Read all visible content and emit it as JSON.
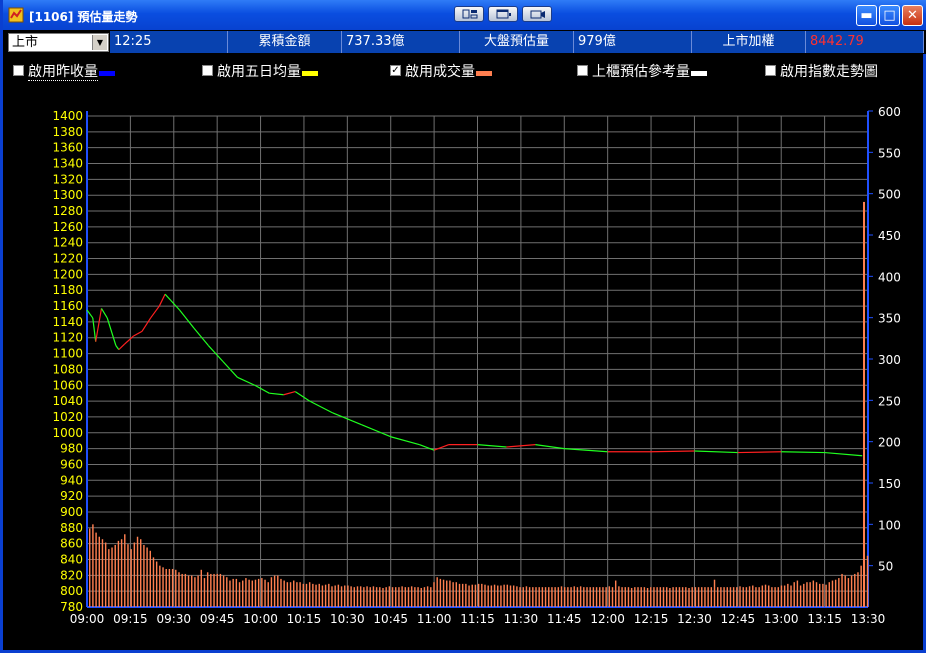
{
  "window": {
    "title": "[1106] 預估量走勢"
  },
  "toolbar": {
    "buttons": [
      "layout-icon",
      "window-icon",
      "camera-icon"
    ]
  },
  "info": {
    "market_select": "上市",
    "time": "12:25",
    "cumulative_label": "累積金額",
    "cumulative_value": "737.33億",
    "estimate_label": "大盤預估量",
    "estimate_value": "979億",
    "index_label": "上市加權",
    "index_value": "8442.79"
  },
  "options": [
    {
      "label": "啟用昨收量",
      "checked": false,
      "color": "#0000ff"
    },
    {
      "label": "啟用五日均量",
      "checked": false,
      "color": "#ffff00"
    },
    {
      "label": "啟用成交量",
      "checked": true,
      "color": "#ff7f50"
    },
    {
      "label": "上櫃預估參考量",
      "checked": false,
      "color": "#ffffff"
    },
    {
      "label": "啟用指數走勢圖",
      "checked": false,
      "color": ""
    }
  ],
  "colors": {
    "left_axis": "#ffff00",
    "right_axis": "#ffffff",
    "up": "#ff2020",
    "down": "#20ff20",
    "bars": "#ff7f50",
    "grid": "#707070"
  },
  "chart_data": {
    "type": "line",
    "title": "",
    "x_ticks": [
      "09:00",
      "09:15",
      "09:30",
      "09:45",
      "10:00",
      "10:15",
      "10:30",
      "10:45",
      "11:00",
      "11:15",
      "11:30",
      "11:45",
      "12:00",
      "12:15",
      "12:30",
      "12:45",
      "13:00",
      "13:15",
      "13:30"
    ],
    "y_left_ticks": [
      1400,
      1380,
      1360,
      1340,
      1320,
      1300,
      1280,
      1260,
      1240,
      1220,
      1200,
      1180,
      1160,
      1140,
      1120,
      1100,
      1080,
      1060,
      1040,
      1020,
      1000,
      980,
      960,
      940,
      920,
      900,
      880,
      860,
      840,
      820,
      800,
      780
    ],
    "y_right_ticks": [
      600,
      550,
      500,
      450,
      400,
      350,
      300,
      250,
      200,
      150,
      100,
      50
    ],
    "ylim_left": [
      780,
      1400
    ],
    "ylim_right": [
      0,
      600
    ],
    "series": [
      {
        "values": [
          {
            "t": "09:00",
            "v": 1155
          },
          {
            "t": "09:02",
            "v": 1145
          },
          {
            "t": "09:03",
            "v": 1115
          },
          {
            "t": "09:05",
            "v": 1157
          },
          {
            "t": "09:07",
            "v": 1145
          },
          {
            "t": "09:10",
            "v": 1110
          },
          {
            "t": "09:11",
            "v": 1105
          },
          {
            "t": "09:13",
            "v": 1112
          },
          {
            "t": "09:16",
            "v": 1122
          },
          {
            "t": "09:19",
            "v": 1128
          },
          {
            "t": "09:22",
            "v": 1145
          },
          {
            "t": "09:25",
            "v": 1160
          },
          {
            "t": "09:27",
            "v": 1175
          },
          {
            "t": "09:29",
            "v": 1167
          },
          {
            "t": "09:32",
            "v": 1155
          },
          {
            "t": "09:37",
            "v": 1132
          },
          {
            "t": "09:42",
            "v": 1110
          },
          {
            "t": "09:47",
            "v": 1090
          },
          {
            "t": "09:52",
            "v": 1070
          },
          {
            "t": "09:58",
            "v": 1060
          },
          {
            "t": "10:03",
            "v": 1050
          },
          {
            "t": "10:08",
            "v": 1048
          },
          {
            "t": "10:12",
            "v": 1052
          },
          {
            "t": "10:17",
            "v": 1040
          },
          {
            "t": "10:25",
            "v": 1025
          },
          {
            "t": "10:35",
            "v": 1010
          },
          {
            "t": "10:45",
            "v": 995
          },
          {
            "t": "10:55",
            "v": 985
          },
          {
            "t": "11:00",
            "v": 978
          },
          {
            "t": "11:05",
            "v": 985
          },
          {
            "t": "11:15",
            "v": 985
          },
          {
            "t": "11:25",
            "v": 982
          },
          {
            "t": "11:35",
            "v": 985
          },
          {
            "t": "11:45",
            "v": 980
          },
          {
            "t": "12:00",
            "v": 976
          },
          {
            "t": "12:15",
            "v": 976
          },
          {
            "t": "12:30",
            "v": 977
          },
          {
            "t": "12:45",
            "v": 975
          },
          {
            "t": "13:00",
            "v": 976
          },
          {
            "t": "13:15",
            "v": 975
          },
          {
            "t": "13:28",
            "v": 971
          }
        ]
      }
    ],
    "volume_bars": [
      95,
      100,
      90,
      85,
      82,
      78,
      70,
      72,
      75,
      80,
      82,
      88,
      76,
      70,
      78,
      85,
      82,
      75,
      72,
      68,
      60,
      55,
      50,
      48,
      46,
      46,
      46,
      45,
      42,
      40,
      40,
      38,
      38,
      36,
      38,
      45,
      35,
      42,
      40,
      40,
      40,
      40,
      38,
      36,
      32,
      34,
      34,
      30,
      32,
      35,
      33,
      32,
      33,
      34,
      35,
      33,
      30,
      36,
      38,
      38,
      34,
      32,
      30,
      30,
      32,
      30,
      30,
      28,
      28,
      30,
      28,
      27,
      28,
      26,
      27,
      28,
      25,
      26,
      27,
      25,
      26,
      26,
      25,
      24,
      25,
      25,
      24,
      25,
      24,
      25,
      24,
      24,
      23,
      24,
      25,
      24,
      24,
      24,
      25,
      24,
      24,
      25,
      24,
      24,
      23,
      24,
      25,
      24,
      30,
      36,
      34,
      33,
      32,
      32,
      30,
      30,
      28,
      28,
      28,
      26,
      27,
      27,
      28,
      28,
      27,
      26,
      26,
      27,
      26,
      26,
      27,
      27,
      26,
      26,
      25,
      24,
      24,
      25,
      24,
      24,
      24,
      24,
      24,
      24,
      24,
      24,
      24,
      24,
      25,
      24,
      24,
      24,
      25,
      24,
      25,
      24,
      24,
      24,
      24,
      24,
      24,
      24,
      24,
      25,
      24,
      32,
      25,
      24,
      24,
      24,
      23,
      24,
      24,
      24,
      24,
      23,
      24,
      24,
      24,
      24,
      24,
      24,
      23,
      24,
      24,
      24,
      24,
      24,
      23,
      24,
      24,
      24,
      24,
      24,
      24,
      24,
      33,
      24,
      24,
      24,
      24,
      24,
      24,
      24,
      25,
      24,
      24,
      25,
      26,
      24,
      24,
      26,
      27,
      26,
      24,
      24,
      24,
      26,
      26,
      28,
      26,
      30,
      32,
      26,
      28,
      30,
      30,
      32,
      30,
      28,
      28,
      27,
      30,
      32,
      33,
      35,
      40,
      38,
      35,
      38,
      40,
      42,
      50,
      56,
      62
    ]
  }
}
